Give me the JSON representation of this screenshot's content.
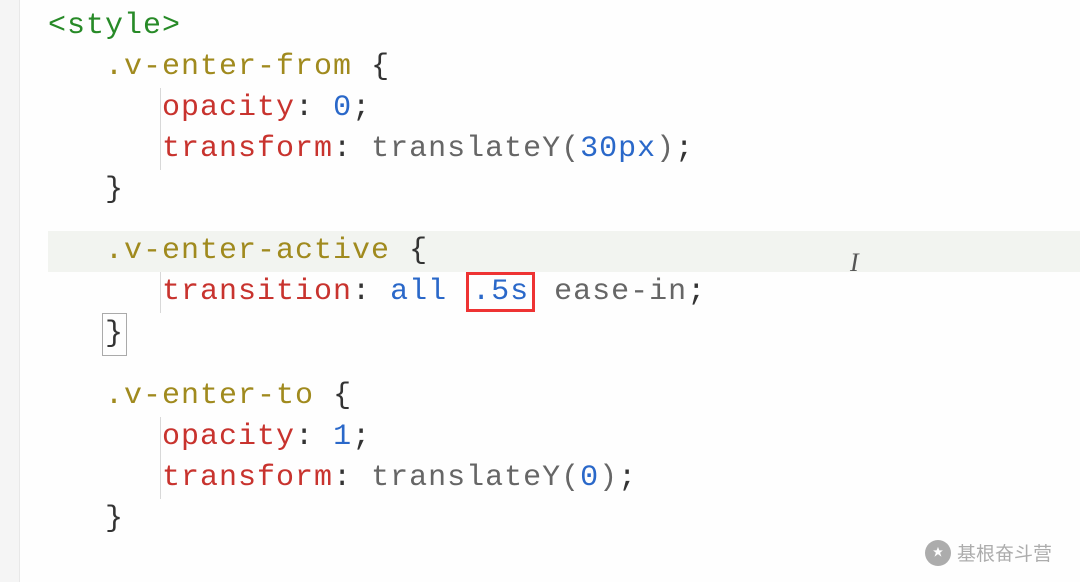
{
  "code": {
    "open_tag_open": "<",
    "open_tag_name": "style",
    "open_tag_close": ">",
    "rule1": {
      "selector": ".v-enter-from",
      "open_brace": " {",
      "prop1": "opacity",
      "val1": "0",
      "prop2": "transform",
      "val2_fn": "translateY",
      "val2_arg": "30px",
      "close_brace": "}"
    },
    "rule2": {
      "selector": ".v-enter-active",
      "open_brace": " {",
      "prop1": "transition",
      "val1_kw1": "all",
      "val1_dur": ".5s",
      "val1_ease": "ease-in",
      "close_brace": "}"
    },
    "rule3": {
      "selector": ".v-enter-to",
      "open_brace": " {",
      "prop1": "opacity",
      "val1": "1",
      "prop2": "transform",
      "val2_fn": "translateY",
      "val2_arg": "0",
      "close_brace": "}"
    },
    "colon": ":",
    "semi": ";",
    "paren_open": "(",
    "paren_close": ")"
  },
  "cursor_glyph": "I",
  "watermark_text": "基根奋斗营"
}
